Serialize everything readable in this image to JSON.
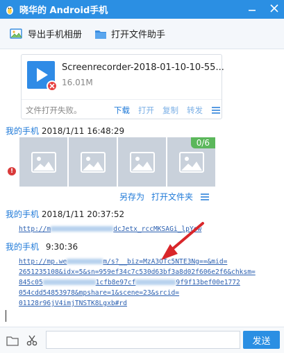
{
  "window": {
    "title": "晓华的 Android手机"
  },
  "toolbar": {
    "export_album": "导出手机相册",
    "open_file_helper": "打开文件助手"
  },
  "file_message": {
    "file_name": "Screenrecorder-2018-01-10-10-55...",
    "file_size": "16.01M",
    "status": "文件打开失败。",
    "actions": [
      "下载",
      "打开",
      "复制",
      "转发"
    ]
  },
  "messages": [
    {
      "sender": "我的手机",
      "time": "2018/1/11 16:48:29"
    },
    {
      "sender": "我的手机",
      "time": "2018/1/11 20:37:52"
    },
    {
      "sender": "我的手机",
      "time": "9:30:36"
    }
  ],
  "photos": {
    "progress_badge": "0/6",
    "progress_fraction": 0,
    "actions": [
      "另存为",
      "打开文件夹"
    ],
    "error_mark": "!"
  },
  "link1": {
    "start": "http://m",
    "end": "dcJetx_rccMKSAGi_lpYow"
  },
  "link2": {
    "line1_start": "http://mp.we",
    "line1_mid": "m/s?__biz=MzA3OTc5NTE3Ng==&mid=",
    "line2": "2651235108&idx=5&sn=959ef34c7c530d63bf3a8d02f606e2f6&chksm=",
    "line3_start": "845c05",
    "line3_mid": "1cfb8e97cf",
    "line3_end": "9f9f13bef00e1772",
    "line4": "054cdd54853978&mpshare=1&scene=23&srcid=",
    "line5": "01128r96jV4imjTNSTK8Lgxb#rd"
  },
  "composer": {
    "send_label": "发送"
  },
  "colors": {
    "titlebar": "#2b8fe3",
    "link": "#2a5fb0",
    "accent": "#1e79d8",
    "arrow": "#d9262a",
    "badge": "#5bb75b"
  }
}
